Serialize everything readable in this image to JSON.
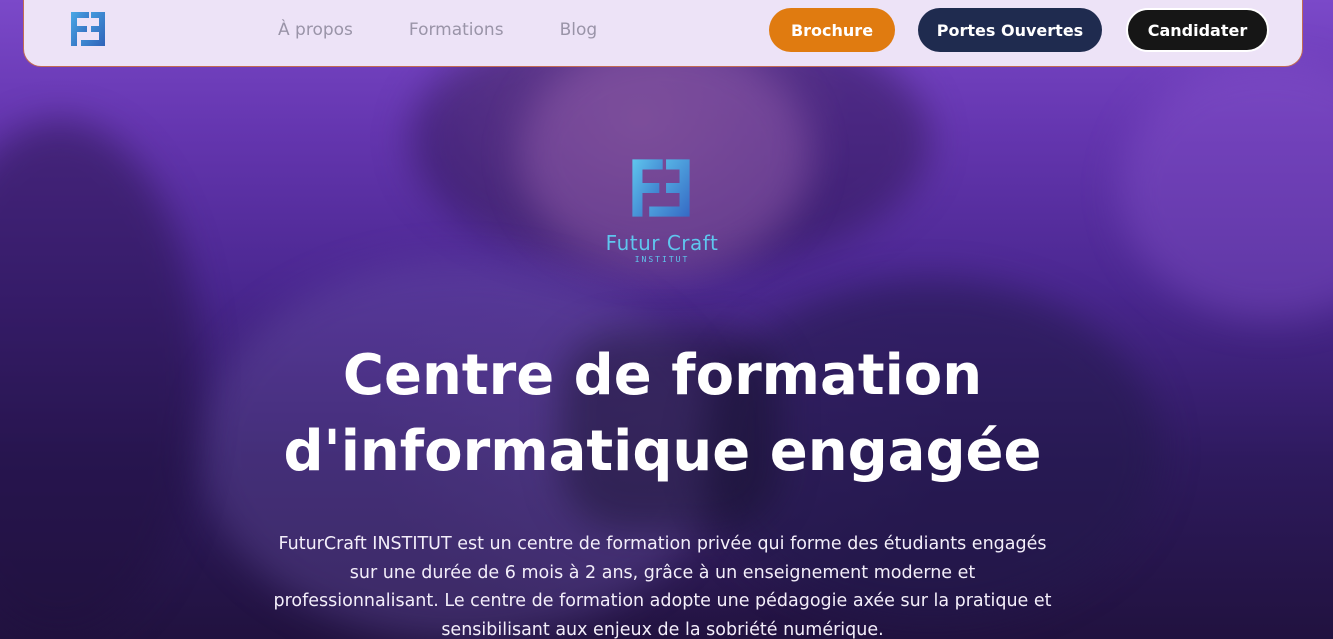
{
  "nav": {
    "links": [
      "À propos",
      "Formations",
      "Blog"
    ],
    "buttons": {
      "brochure": "Brochure",
      "portes_ouvertes": "Portes Ouvertes",
      "candidater": "Candidater"
    },
    "logo_icon": "futurcraft-logo-icon"
  },
  "hero": {
    "brand_name": "Futur Craft",
    "brand_sub": "INSTITUT",
    "headline_line1": "Centre de formation",
    "headline_line2": "d'informatique engagée",
    "description": "FuturCraft INSTITUT est un centre de formation privée qui forme des étudiants engagés sur une durée de 6 mois à 2 ans, grâce à un enseignement moderne et professionnalisant. Le centre de formation adopte une pédagogie axée sur la pratique et sensibilisant aux enjeux de la sobriété numérique."
  },
  "colors": {
    "brochure": "#e07b10",
    "portes_ouvertes": "#1f2b4f",
    "candidater": "#161616",
    "brand_blue": "#5fc6ee",
    "navbar_bg": "#ede3f7"
  }
}
